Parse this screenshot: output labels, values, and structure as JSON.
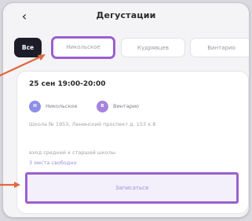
{
  "header": {
    "back_glyph": "‹",
    "title": "Дегустации"
  },
  "tabs": [
    {
      "label": "Все",
      "state": "active"
    },
    {
      "label": "Никольское",
      "state": "highlighted"
    },
    {
      "label": "Кудрявцев",
      "state": "normal"
    },
    {
      "label": "Винтарио",
      "state": "normal"
    }
  ],
  "card": {
    "datetime": "25 сен 19:00-20:00",
    "tags": [
      {
        "initials": "Н",
        "label": "Никольское"
      },
      {
        "initials": "В",
        "label": "Винтарио"
      }
    ],
    "address": "Школа № 1953, Ленинский проспект д. 153 к.8",
    "note": "вход средний к старшей школы",
    "seats": "3 места свободно",
    "signup_label": "Записаться"
  },
  "colors": {
    "highlight": "#9b5fd1",
    "arrow": "#e0683a",
    "active_tab": "#1d1d2a"
  }
}
